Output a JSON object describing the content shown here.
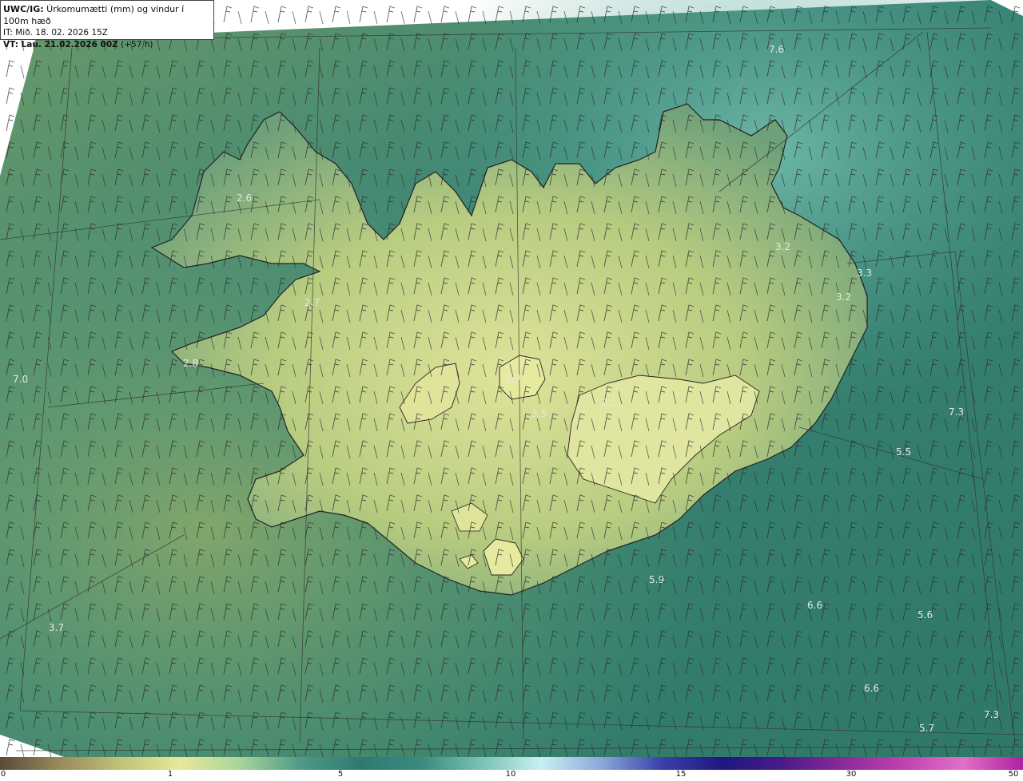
{
  "header": {
    "product_prefix": "UWC/IG:",
    "product_title": " Úrkomumætti (mm) og vindur í 100m hæð",
    "init_time": "IT: Mið. 18. 02. 2026 15Z",
    "valid_prefix": "VT: Lau. 21.02.2026 00Z",
    "valid_suffix": " (+57 h)"
  },
  "colorbar": {
    "ticks": [
      "0",
      "1",
      "5",
      "10",
      "15",
      "30",
      "50"
    ],
    "colors": [
      "#5a4a3a",
      "#9a8a5a",
      "#c2c278",
      "#e8e89a",
      "#a8d49a",
      "#4e9a86",
      "#2e7a72",
      "#3a8a80",
      "#7ac2b4",
      "#c8f0f0",
      "#8aa8d8",
      "#3a40a8",
      "#1e1880",
      "#4a1a8a",
      "#8a2a9a",
      "#c040b0",
      "#e070c8",
      "#b020a0"
    ]
  },
  "map": {
    "background_colors": {
      "sea": "#2f7a6c",
      "sea_light": "#4c9a88",
      "land_low": "#7aa870",
      "land_high": "#d8e090",
      "coast": "#222222"
    },
    "value_labels": [
      "7.6",
      "2.6",
      "2.7",
      "2.8",
      "7.0",
      "3.2",
      "3.3",
      "3.2",
      "1.0",
      "3.5",
      "2.2",
      "7.3",
      "5.5",
      "5.9",
      "6.6",
      "5.6",
      "3.7",
      "6.6",
      "7.3",
      "5.7"
    ]
  }
}
